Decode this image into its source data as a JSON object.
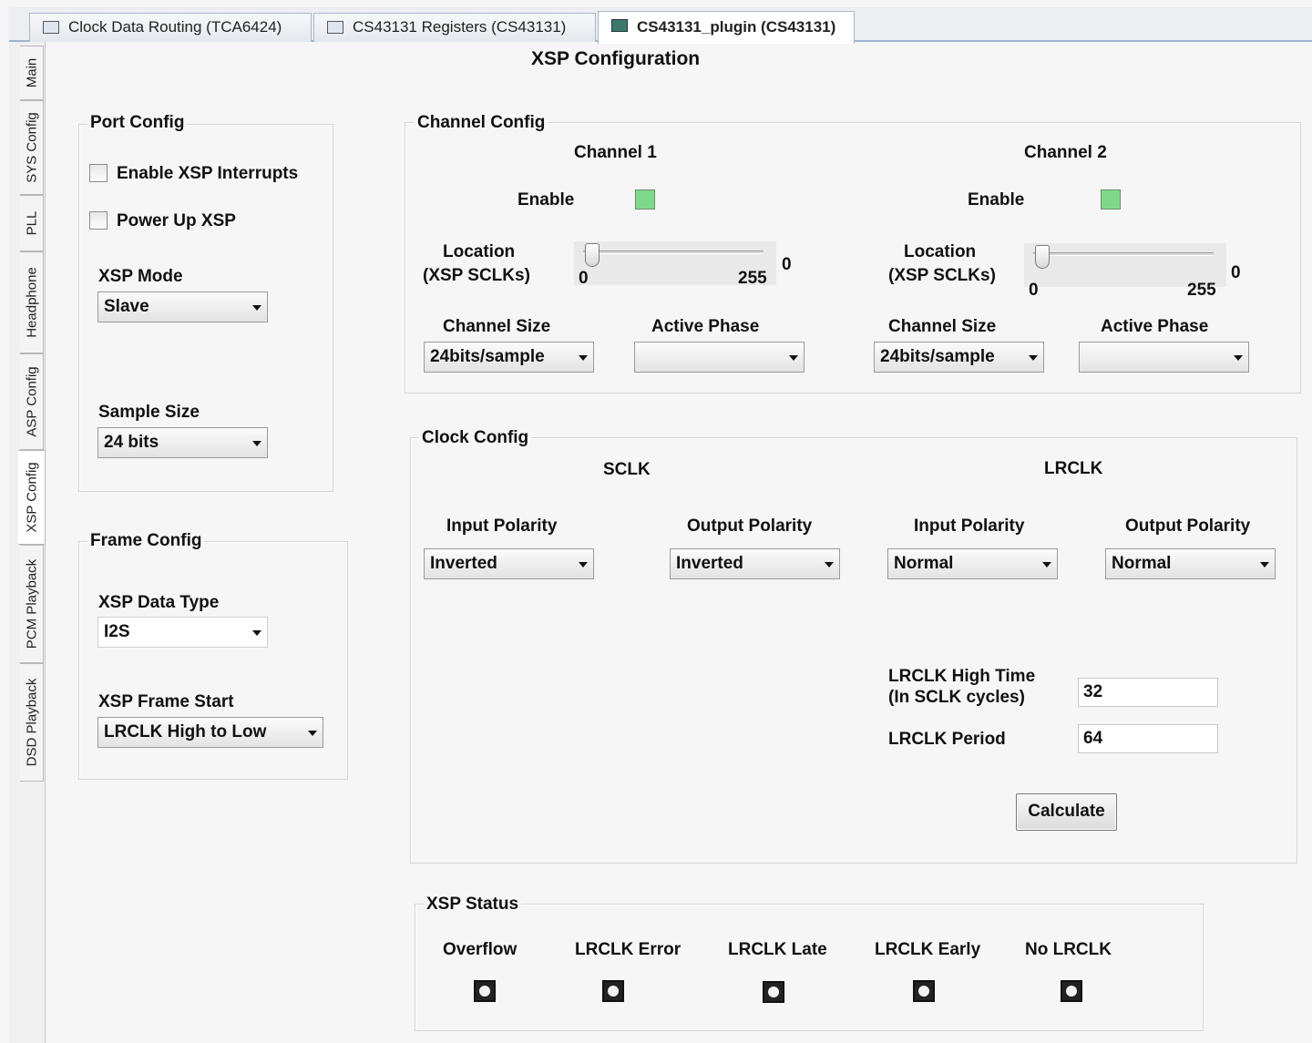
{
  "tabs": [
    {
      "label": "Clock Data Routing (TCA6424)",
      "active": false
    },
    {
      "label": "CS43131 Registers (CS43131)",
      "active": false
    },
    {
      "label": "CS43131_plugin (CS43131)",
      "active": true
    }
  ],
  "side_tabs": [
    "Main",
    "SYS Config",
    "PLL",
    "Headphone",
    "ASP Config",
    "XSP Config",
    "PCM Playback",
    "DSD Playback"
  ],
  "page_title": "XSP Configuration",
  "port_config": {
    "title": "Port Config",
    "enable_interrupts_label": "Enable XSP Interrupts",
    "enable_interrupts_checked": false,
    "power_up_label": "Power Up XSP",
    "power_up_checked": false,
    "mode_label": "XSP Mode",
    "mode_value": "Slave",
    "sample_size_label": "Sample Size",
    "sample_size_value": "24 bits"
  },
  "frame_config": {
    "title": "Frame Config",
    "data_type_label": "XSP Data Type",
    "data_type_value": "I2S",
    "frame_start_label": "XSP Frame Start",
    "frame_start_value": "LRCLK High to Low"
  },
  "channel_config": {
    "title": "Channel Config",
    "channels": [
      {
        "name": "Channel 1",
        "enable_label": "Enable",
        "enabled": true,
        "location_label_1": "Location",
        "location_label_2": "(XSP SCLKs)",
        "slider_min": "0",
        "slider_max": "255",
        "slider_value": "0",
        "size_label": "Channel Size",
        "size_value": "24bits/sample",
        "phase_label": "Active Phase",
        "phase_value": ""
      },
      {
        "name": "Channel 2",
        "enable_label": "Enable",
        "enabled": true,
        "location_label_1": "Location",
        "location_label_2": "(XSP SCLKs)",
        "slider_min": "0",
        "slider_max": "255",
        "slider_value": "0",
        "size_label": "Channel Size",
        "size_value": "24bits/sample",
        "phase_label": "Active Phase",
        "phase_value": ""
      }
    ]
  },
  "clock_config": {
    "title": "Clock Config",
    "sclk": {
      "heading": "SCLK",
      "input_polarity_label": "Input Polarity",
      "input_polarity_value": "Inverted",
      "output_polarity_label": "Output Polarity",
      "output_polarity_value": "Inverted"
    },
    "lrclk": {
      "heading": "LRCLK",
      "input_polarity_label": "Input Polarity",
      "input_polarity_value": "Normal",
      "output_polarity_label": "Output Polarity",
      "output_polarity_value": "Normal"
    },
    "high_time_label_1": "LRCLK High Time",
    "high_time_label_2": "(In SCLK cycles)",
    "high_time_value": "32",
    "period_label": "LRCLK Period",
    "period_value": "64",
    "calculate_label": "Calculate"
  },
  "xsp_status": {
    "title": "XSP Status",
    "indicators": [
      "Overflow",
      "LRCLK Error",
      "LRCLK Late",
      "LRCLK Early",
      "No LRCLK"
    ]
  },
  "colors": {
    "led_on": "#7ed98a",
    "tab_border": "#9fb4cf"
  },
  "icons": {
    "tab_1": "window-icon",
    "tab_2": "table-icon",
    "tab_3": "plugin-icon"
  }
}
